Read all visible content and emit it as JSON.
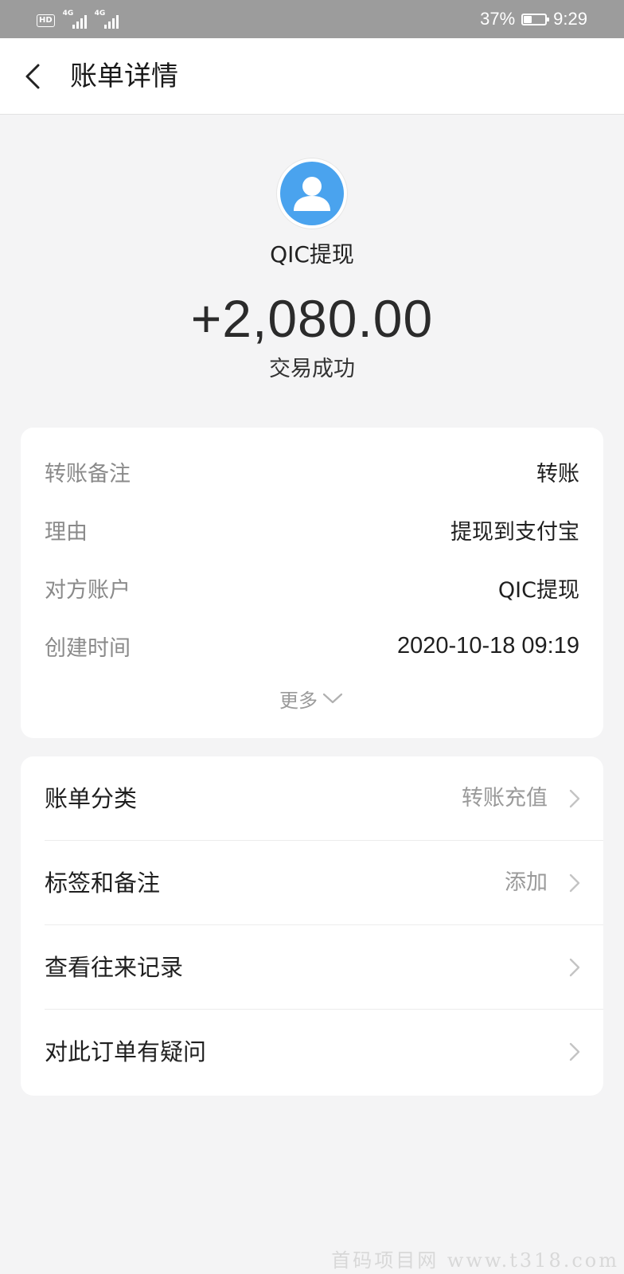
{
  "status_bar": {
    "hd_label": "HD",
    "network_labels": [
      "4G",
      "4G"
    ],
    "battery_percent_text": "37%",
    "battery_level": 0.37,
    "time": "9:29"
  },
  "header": {
    "back_icon": "chevron-left-icon",
    "title": "账单详情"
  },
  "transaction": {
    "avatar_icon": "user-avatar-icon",
    "avatar_color": "#4aa3ee",
    "counterparty": "QIC提现",
    "amount": "+2,080.00",
    "status": "交易成功"
  },
  "details": {
    "rows": [
      {
        "label": "转账备注",
        "value": "转账"
      },
      {
        "label": "理由",
        "value": "提现到支付宝"
      },
      {
        "label": "对方账户",
        "value": "QIC提现"
      },
      {
        "label": "创建时间",
        "value": "2020-10-18 09:19"
      }
    ],
    "more_label": "更多",
    "more_icon": "chevron-down-icon"
  },
  "actions": [
    {
      "label": "账单分类",
      "value": "转账充值",
      "icon": "chevron-right-icon"
    },
    {
      "label": "标签和备注",
      "value": "添加",
      "icon": "chevron-right-icon"
    },
    {
      "label": "查看往来记录",
      "value": "",
      "icon": "chevron-right-icon"
    },
    {
      "label": "对此订单有疑问",
      "value": "",
      "icon": "chevron-right-icon"
    }
  ],
  "watermark": "首码项目网 www.t318.com",
  "colors": {
    "status_bar_bg": "#9c9c9c",
    "page_bg": "#f4f4f5",
    "card_bg": "#ffffff",
    "secondary_text": "#8a8a8a",
    "avatar_blue": "#4aa3ee"
  }
}
